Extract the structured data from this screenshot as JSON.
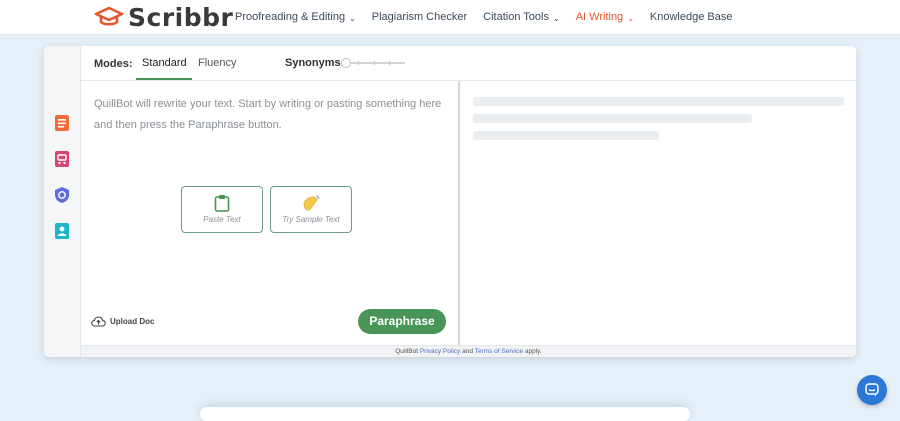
{
  "brand": {
    "name": "Scribbr",
    "color": "#e8542b"
  },
  "nav": {
    "items": [
      {
        "label": "Proofreading & Editing",
        "has_caret": true
      },
      {
        "label": "Plagiarism Checker",
        "has_caret": false
      },
      {
        "label": "Citation Tools",
        "has_caret": true
      },
      {
        "label": "AI Writing",
        "has_caret": true,
        "active": true
      },
      {
        "label": "Knowledge Base",
        "has_caret": false
      }
    ],
    "caret": "⌄"
  },
  "sidebar": {
    "icons": [
      "paraphraser-icon",
      "grammar-checker-icon",
      "plagiarism-checker-icon",
      "ai-detector-icon"
    ]
  },
  "modes": {
    "label": "Modes:",
    "tabs": [
      {
        "label": "Standard",
        "active": true
      },
      {
        "label": "Fluency",
        "active": false
      }
    ],
    "synonyms_label": "Synonyms:",
    "synonyms_level": 0
  },
  "input": {
    "placeholder": "QuillBot will rewrite your text. Start by writing or pasting something here and then press the Paraphrase button.",
    "paste_label": "Paste Text",
    "sample_label": "Try Sample Text",
    "upload_label": "Upload Doc",
    "paraphrase_label": "Paraphrase"
  },
  "footer": {
    "prefix": "QuillBot",
    "privacy": "Privacy Policy",
    "and": "and",
    "terms": "Terms of Service",
    "suffix": "apply."
  },
  "colors": {
    "accent_green": "#499557",
    "nav_active": "#e8542b",
    "chat_blue": "#2a79d6",
    "page_bg": "#e6f0f9"
  }
}
